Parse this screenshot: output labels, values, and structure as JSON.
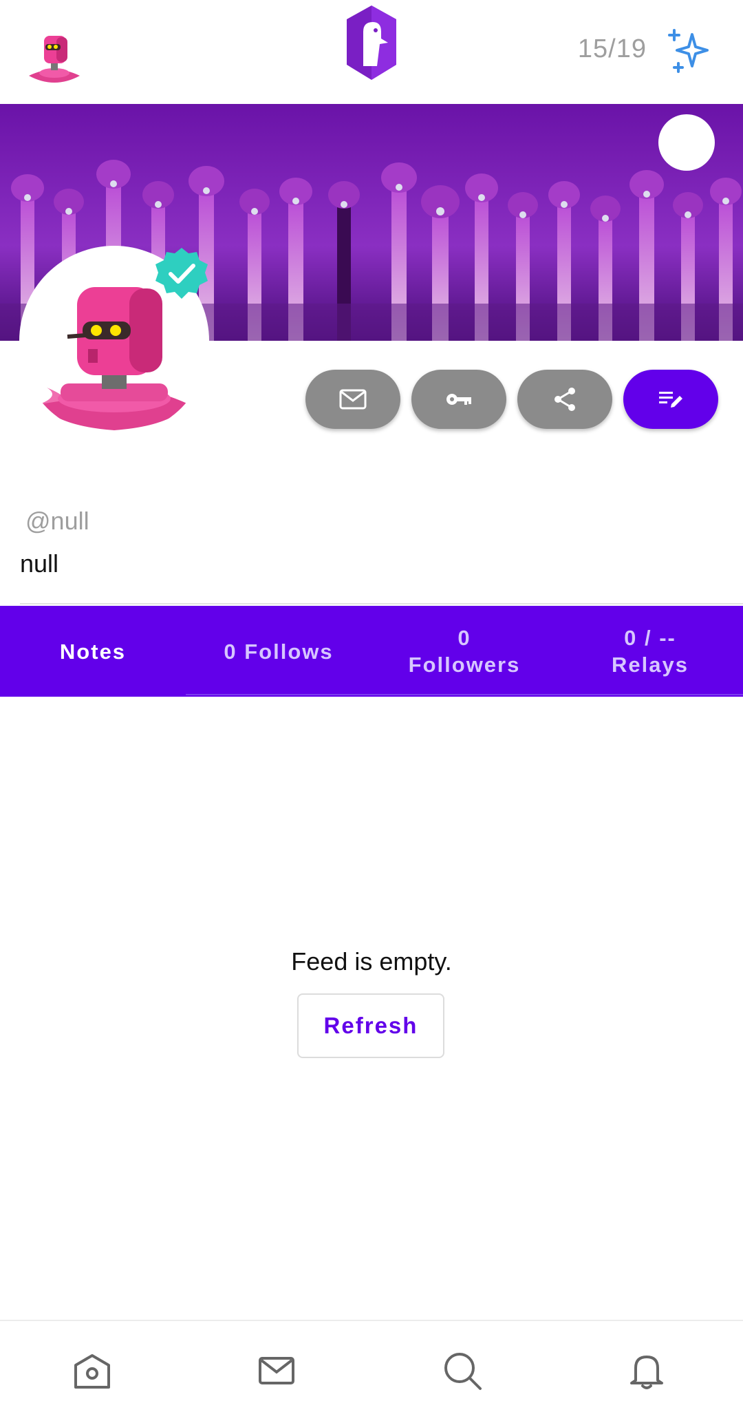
{
  "header": {
    "counter": "15/19"
  },
  "profile": {
    "handle": "@null",
    "display_name": "null"
  },
  "actions": [
    {
      "icon": "mail-icon"
    },
    {
      "icon": "key-icon"
    },
    {
      "icon": "share-icon"
    },
    {
      "icon": "edit-note-icon"
    }
  ],
  "tabs": [
    {
      "label": "Notes",
      "active": true
    },
    {
      "label": "0 Follows",
      "active": false
    },
    {
      "label": "0 Followers",
      "active": false
    },
    {
      "label": "0 / -- Relays",
      "active": false
    }
  ],
  "feed": {
    "empty_text": "Feed is empty.",
    "refresh_label": "Refresh"
  },
  "bottom_nav": [
    {
      "icon": "home-icon"
    },
    {
      "icon": "messages-icon"
    },
    {
      "icon": "search-icon"
    },
    {
      "icon": "notifications-icon"
    }
  ],
  "colors": {
    "accent": "#6200ea",
    "action_gray": "#8b8b8b",
    "verified": "#2ecfc0",
    "banner": "#7a1fb0"
  }
}
